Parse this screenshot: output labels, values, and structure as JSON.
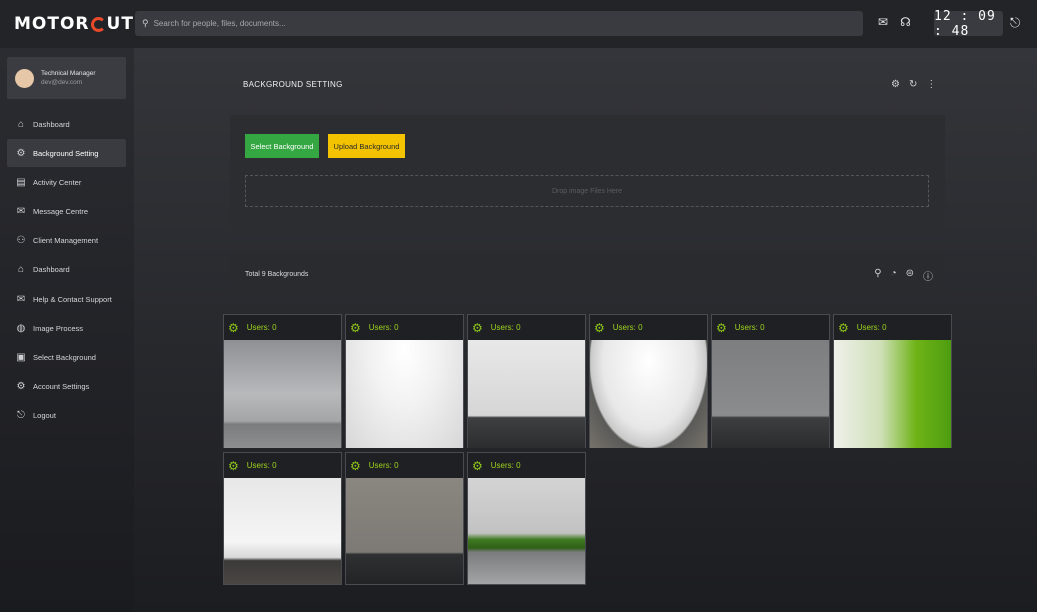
{
  "brand": {
    "logo_left": "MOTOR",
    "logo_right": "UT"
  },
  "search": {
    "placeholder": "Search for people, files, documents..."
  },
  "clock": {
    "time": "12 : 09 : 48"
  },
  "icons": {
    "search": "search-icon",
    "mail": "mail-icon",
    "support": "headset-icon",
    "logout": "logout-icon"
  },
  "profile": {
    "name": "Technical Manager",
    "email": "dev@dev.com"
  },
  "sidebar": {
    "items": [
      {
        "label": "Dashboard",
        "icon": "home-icon",
        "glyph": "⌂"
      },
      {
        "label": "Background Setting",
        "icon": "gear-icon",
        "glyph": "⚙"
      },
      {
        "label": "Activity Center",
        "icon": "activity-icon",
        "glyph": "▤"
      },
      {
        "label": "Message Centre",
        "icon": "mail-icon",
        "glyph": "✉"
      },
      {
        "label": "Client Management",
        "icon": "users-icon",
        "glyph": "⚇"
      },
      {
        "label": "Dashboard",
        "icon": "home-icon",
        "glyph": "⌂"
      },
      {
        "label": "Help & Contact Support",
        "icon": "mail-icon",
        "glyph": "✉"
      },
      {
        "label": "Image Process",
        "icon": "image-process-icon",
        "glyph": "◍"
      },
      {
        "label": "Select Background",
        "icon": "select-background-icon",
        "glyph": "▣"
      },
      {
        "label": "Account Settings",
        "icon": "gear-icon",
        "glyph": "⚙"
      },
      {
        "label": "Logout",
        "icon": "logout-icon",
        "glyph": "⎋"
      }
    ],
    "active_index": 1
  },
  "page": {
    "title": "BACKGROUND SETTING",
    "select_button": "Select Background",
    "upload_button": "Upload Background",
    "dropzone_text": "Drop image Files Here",
    "total_text": "Total 9 Backgrounds"
  },
  "cards": [
    {
      "users": "Users: 0",
      "style": "concrete"
    },
    {
      "users": "Users: 0",
      "style": "white-spot"
    },
    {
      "users": "Users: 0",
      "style": "white-shadow"
    },
    {
      "users": "Users: 0",
      "style": "white-floor"
    },
    {
      "users": "Users: 0",
      "style": "grey-wall"
    },
    {
      "users": "Users: 0",
      "style": "green-pixels"
    },
    {
      "users": "Users: 0",
      "style": "spotlights"
    },
    {
      "users": "Users: 0",
      "style": "wood-concrete"
    },
    {
      "users": "Users: 0",
      "style": "grass-wall"
    }
  ],
  "colors": {
    "accent_green": "#9cd31c",
    "button_green": "#34a743",
    "button_yellow": "#f3c200",
    "logo_red": "#e94b2a"
  }
}
